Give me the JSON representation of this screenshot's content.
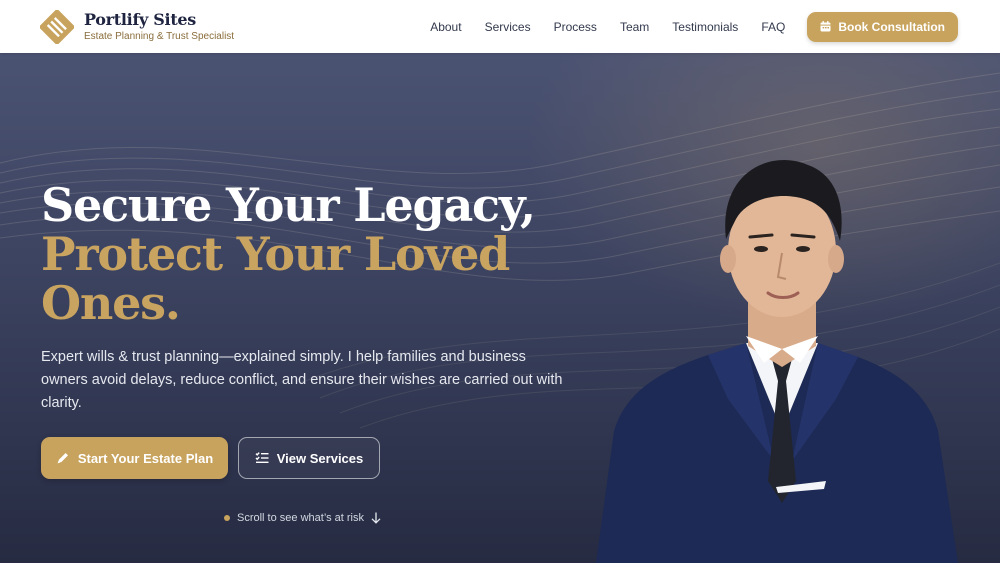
{
  "brand": {
    "name": "Portlify Sites",
    "tagline": "Estate Planning & Trust Specialist"
  },
  "nav": {
    "items": [
      "About",
      "Services",
      "Process",
      "Team",
      "Testimonials",
      "FAQ"
    ],
    "cta_label": "Book Consultation",
    "cta_icon": "calendar-icon"
  },
  "hero": {
    "headline_line1": "Secure Your Legacy,",
    "headline_line2": "Protect Your Loved Ones.",
    "subtitle": "Expert wills & trust planning—explained simply. I help families and business owners avoid delays, reduce conflict, and ensure their wishes are carried out with clarity.",
    "primary_cta": "Start Your Estate Plan",
    "primary_cta_icon": "pen-icon",
    "secondary_cta": "View Services",
    "secondary_cta_icon": "checklist-icon",
    "scroll_hint": "Scroll to see what’s at risk",
    "scroll_icon": "arrow-down-icon"
  },
  "colors": {
    "accent": "#c8a35d",
    "header_bg": "#ffffff",
    "hero_bg_top": "#4b5373",
    "hero_bg_bottom": "#262b42",
    "headline_white": "#ffffff",
    "headline_gold": "#c9a461"
  }
}
